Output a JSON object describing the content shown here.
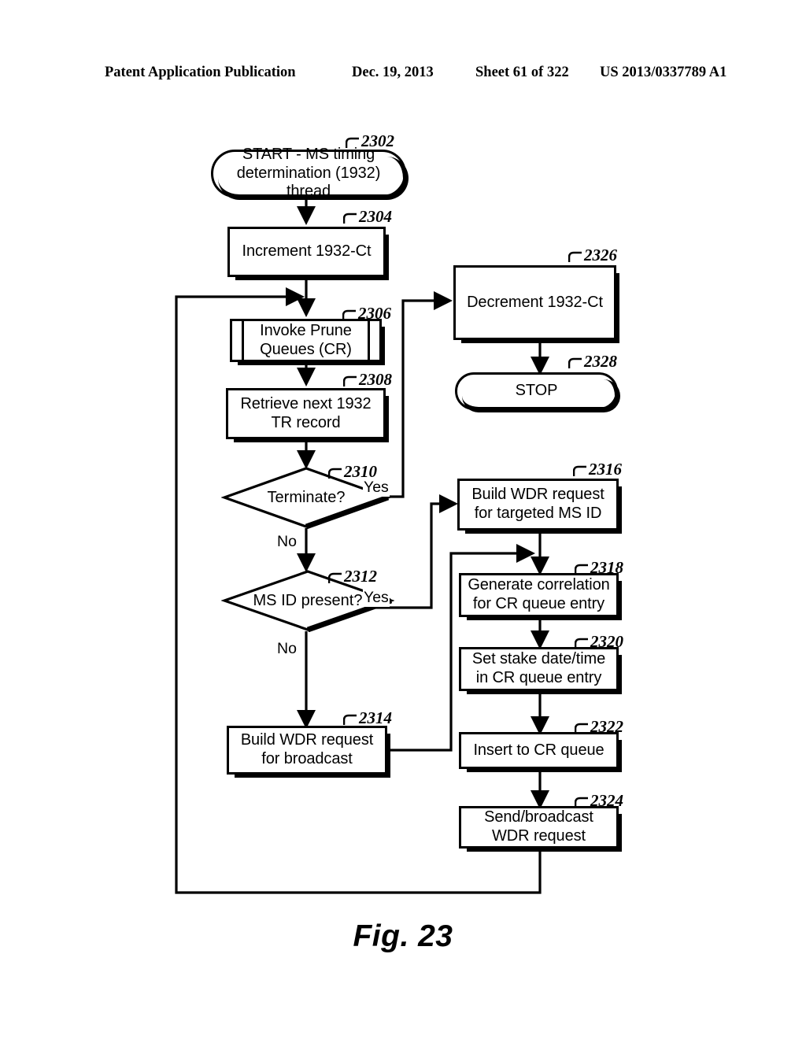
{
  "header": {
    "publication": "Patent Application Publication",
    "date": "Dec. 19, 2013",
    "sheet": "Sheet 61 of 322",
    "patent_number": "US 2013/0337789 A1"
  },
  "figure": {
    "caption": "Fig. 23",
    "nodes": [
      {
        "id": "2302",
        "ref": "2302",
        "type": "terminator",
        "text": "START - MS timing determination (1932) thread"
      },
      {
        "id": "2304",
        "ref": "2304",
        "type": "process",
        "text": "Increment 1932-Ct"
      },
      {
        "id": "2306",
        "ref": "2306",
        "type": "predefined-process",
        "text": "Invoke Prune Queues (CR)"
      },
      {
        "id": "2308",
        "ref": "2308",
        "type": "process",
        "text": "Retrieve next 1932 TR record"
      },
      {
        "id": "2310",
        "ref": "2310",
        "type": "decision",
        "text": "Terminate?"
      },
      {
        "id": "2312",
        "ref": "2312",
        "type": "decision",
        "text": "MS ID present?"
      },
      {
        "id": "2314",
        "ref": "2314",
        "type": "process",
        "text": "Build WDR request for broadcast"
      },
      {
        "id": "2316",
        "ref": "2316",
        "type": "process",
        "text": "Build WDR request for targeted MS ID"
      },
      {
        "id": "2318",
        "ref": "2318",
        "type": "process",
        "text": "Generate correlation for CR queue entry"
      },
      {
        "id": "2320",
        "ref": "2320",
        "type": "process",
        "text": "Set stake date/time in CR queue entry"
      },
      {
        "id": "2322",
        "ref": "2322",
        "type": "process",
        "text": "Insert to CR queue"
      },
      {
        "id": "2324",
        "ref": "2324",
        "type": "process",
        "text": "Send/broadcast WDR request"
      },
      {
        "id": "2326",
        "ref": "2326",
        "type": "process",
        "text": "Decrement 1932-Ct"
      },
      {
        "id": "2328",
        "ref": "2328",
        "type": "terminator",
        "text": "STOP"
      }
    ],
    "branch_labels": {
      "terminate_yes": "Yes",
      "terminate_no": "No",
      "msid_yes": "Yes",
      "msid_no": "No"
    }
  },
  "colors": {
    "ink": "#000000",
    "paper": "#ffffff"
  }
}
